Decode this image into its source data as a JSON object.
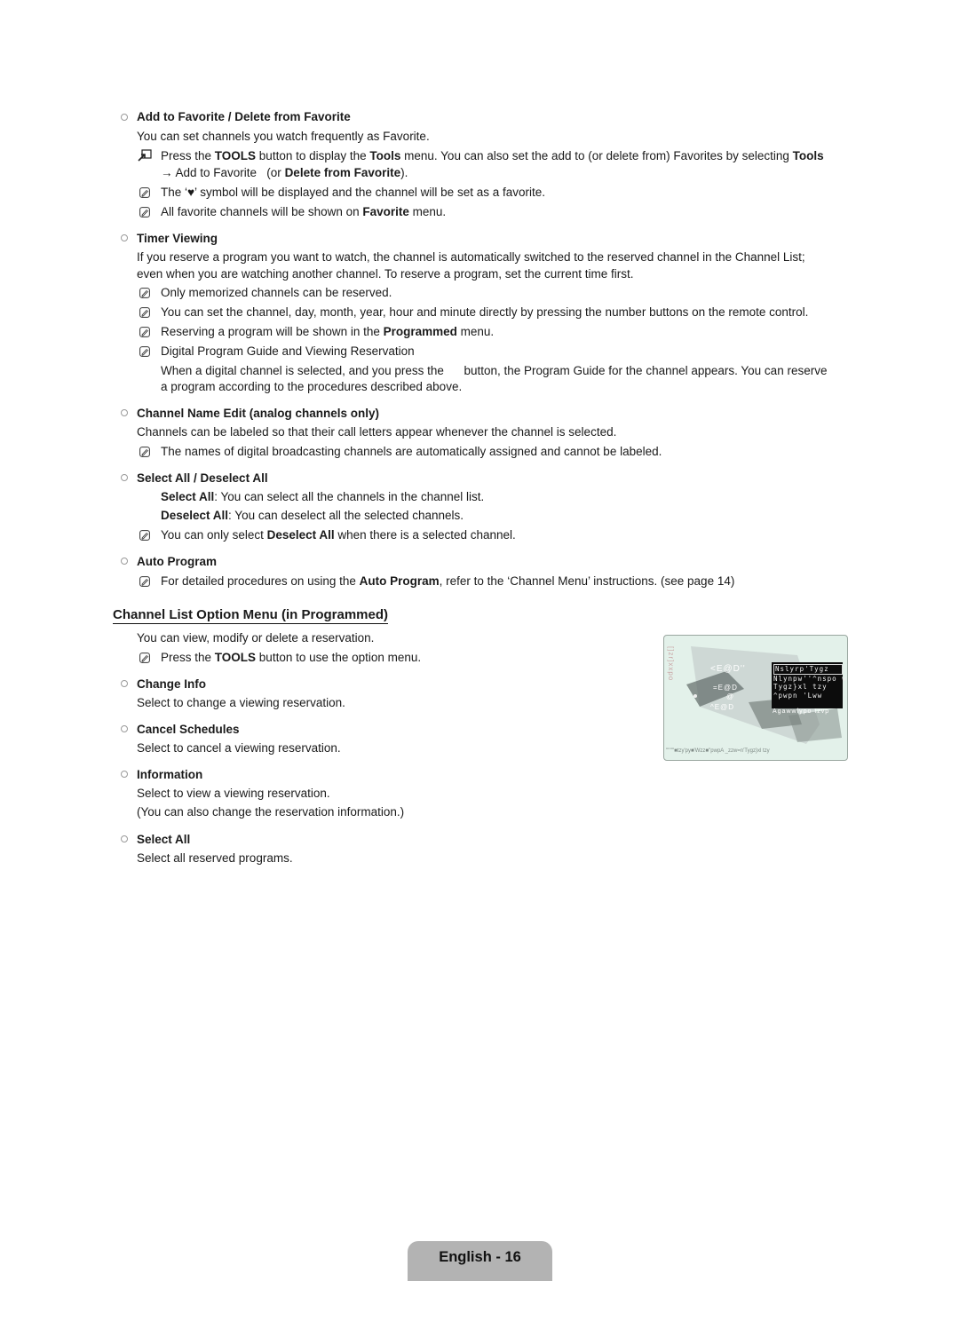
{
  "sections": {
    "favorite": {
      "title": "Add to Favorite / Delete from Favorite",
      "desc": "You can set channels you watch frequently as Favorite.",
      "tools_note": {
        "p1": "Press the ",
        "b1": "TOOLS",
        "p2": " button to display the ",
        "b2": "Tools",
        "p3": " menu. You can also set the add to (or delete from) Favorites by selecting ",
        "b3": "Tools",
        "p4": "→ Add to Favorite   (or ",
        "b4": "Delete from Favorite",
        "p5": ")."
      },
      "note1": {
        "p1": "The ‘",
        "symbol": "♥",
        "p2": "’ symbol will be displayed and the channel will be set as a favorite."
      },
      "note2": {
        "p1": "All favorite channels will be shown on ",
        "b1": "Favorite",
        "p2": " menu."
      }
    },
    "timer": {
      "title": "Timer Viewing",
      "desc1": "If you reserve a program you want to watch, the channel is automatically switched to the reserved channel in the Channel List;",
      "desc2": "even when you are watching another channel. To reserve a program, set the current time first.",
      "note1": "Only memorized channels can be reserved.",
      "note2": "You can set the channel, day, month, year, hour and minute directly by pressing the number buttons on the remote control.",
      "note3": {
        "p1": "Reserving a program will be shown in the ",
        "b1": "Programmed",
        "p2": " menu."
      },
      "note4": "Digital Program Guide and Viewing Reservation",
      "note4_desc1": "When a digital channel is selected, and you press the      button, the Program Guide for the channel appears. You can reserve",
      "note4_desc2": "a program according to the procedures described above."
    },
    "name_edit": {
      "title": "Channel Name Edit (analog channels only)",
      "desc": "Channels can be labeled so that their call letters appear whenever the channel is selected.",
      "note": "The names of digital broadcasting channels are automatically assigned and cannot be labeled."
    },
    "select_all": {
      "title": "Select All / Deselect All",
      "line1": {
        "b": "Select All",
        "t": ": You can select all the channels in the channel list."
      },
      "line2": {
        "b": "Deselect All",
        "t": ": You can deselect all the selected channels."
      },
      "note": {
        "p1": "You can only select ",
        "b1": "Deselect All",
        "p2": " when there is a selected channel."
      }
    },
    "auto_program": {
      "title": "Auto Program",
      "note": {
        "p1": "For detailed procedures on using the ",
        "b1": "Auto Program",
        "p2": ", refer to the ‘Channel Menu’ instructions. (see page 14)"
      }
    },
    "option_menu": {
      "title": "Channel List Option Menu (in Programmed)",
      "desc": "You can view, modify or delete a reservation.",
      "note": {
        "p1": "Press the ",
        "b1": "TOOLS",
        "p2": " button to use the option menu."
      },
      "items": [
        {
          "title": "Change Info",
          "desc": "Select to change a viewing reservation."
        },
        {
          "title": "Cancel Schedules",
          "desc": "Select to cancel a viewing reservation."
        },
        {
          "title": "Information",
          "desc": "Select to view a viewing reservation.",
          "desc2": "(You can also change the reservation information.)"
        },
        {
          "title": "Select All",
          "desc": "Select all reserved programs."
        }
      ]
    }
  },
  "screen": {
    "side_label": "[]zr]xxpo",
    "rows": [
      "<E@D''",
      "=E@D",
      "@",
      "^E@D"
    ],
    "osd_items": [
      "Nslyrp'Tygz",
      "Nlynpw''^nspo wp",
      "Tygz}xl tzy",
      "^pwpn 'Lww"
    ],
    "overflow_text": "Agawwlypo  tzvp",
    "footer": "''''''''■tzy'py■'Wzz■''pwpA _zzw=n'Tygz}xl tzy"
  },
  "footer": {
    "label": "English - 16"
  }
}
